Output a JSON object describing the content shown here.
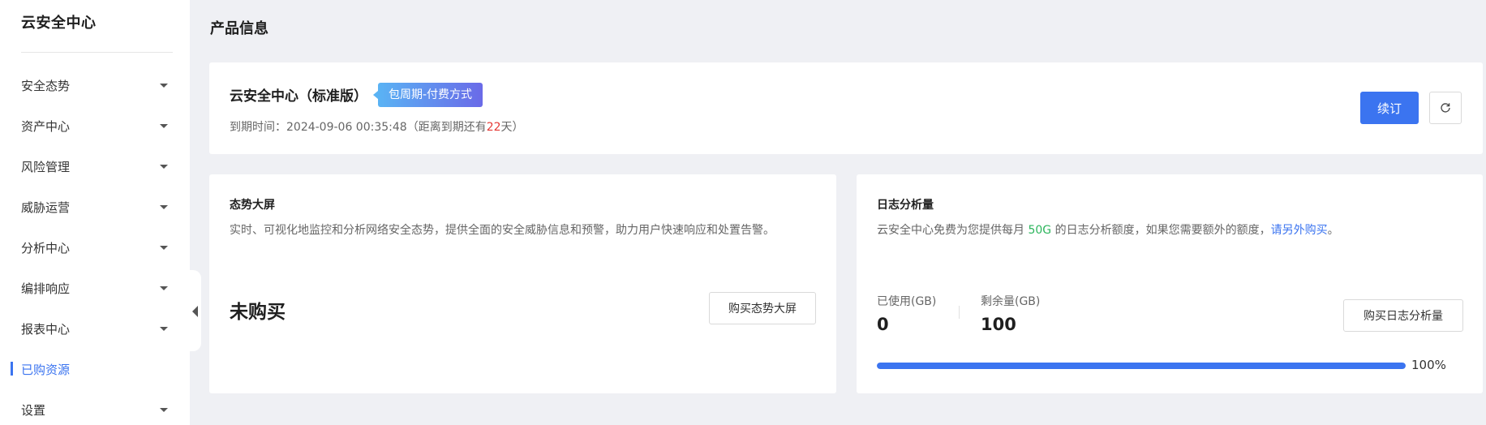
{
  "sidebar": {
    "title": "云安全中心",
    "items": [
      {
        "label": "安全态势"
      },
      {
        "label": "资产中心"
      },
      {
        "label": "风险管理"
      },
      {
        "label": "威胁运营"
      },
      {
        "label": "分析中心"
      },
      {
        "label": "编排响应"
      },
      {
        "label": "报表中心"
      },
      {
        "label": "已购资源",
        "active": true
      },
      {
        "label": "设置"
      }
    ]
  },
  "page": {
    "title": "产品信息"
  },
  "product": {
    "name": "云安全中心（标准版）",
    "billing_tag": "包周期-付费方式",
    "expiry_prefix": "到期时间：2024-09-06 00:35:48（距离到期还有",
    "expiry_days": "22",
    "expiry_suffix": "天）",
    "renew_label": "续订",
    "refresh_icon": "refresh-icon"
  },
  "screen_card": {
    "title": "态势大屏",
    "description": "实时、可视化地监控和分析网络安全态势，提供全面的安全威胁信息和预警，助力用户快速响应和处置告警。",
    "status": "未购买",
    "button_label": "购买态势大屏"
  },
  "log_card": {
    "title": "日志分析量",
    "desc_before": "云安全中心免费为您提供每月 ",
    "desc_quota": "50G",
    "desc_middle": " 的日志分析额度，如果您需要额外的额度，",
    "desc_link": "请另外购买",
    "desc_end": "。",
    "used_label": "已使用(GB)",
    "used_value": "0",
    "remaining_label": "剩余量(GB)",
    "remaining_value": "100",
    "progress_percent": 100,
    "progress_text": "100%",
    "button_label": "购买日志分析量"
  },
  "colors": {
    "accent": "#3b74f0",
    "warning_red": "#e53935",
    "quota_green": "#2db55d"
  }
}
